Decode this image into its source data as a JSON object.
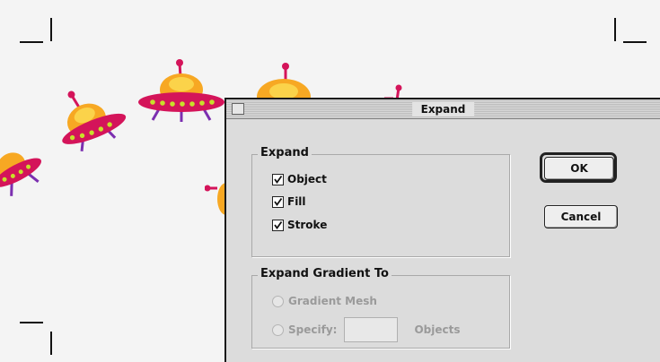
{
  "dialog": {
    "title": "Expand",
    "expand_group": {
      "label": "Expand",
      "options": [
        {
          "label": "Object",
          "checked": true
        },
        {
          "label": "Fill",
          "checked": true
        },
        {
          "label": "Stroke",
          "checked": true
        }
      ]
    },
    "gradient_group": {
      "label": "Expand Gradient To",
      "gradient_mesh_label": "Gradient Mesh",
      "specify_label": "Specify:",
      "specify_value": "",
      "objects_label": "Objects"
    },
    "ok_label": "OK",
    "cancel_label": "Cancel"
  },
  "colors": {
    "ufo_body": "#d4145a",
    "ufo_dome": "#f7a823",
    "ufo_lights": "#c8e02a",
    "ufo_legs": "#7b2fb0"
  }
}
